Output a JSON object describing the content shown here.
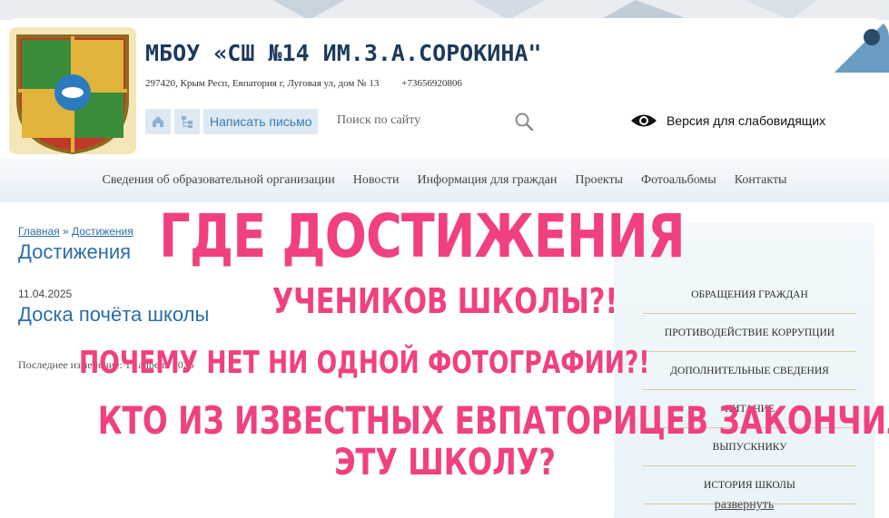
{
  "header": {
    "site_title": "МБОУ «СШ №14 ИМ.З.А.СОРОКИНА\"",
    "address": "297420, Крым Респ, Евпатория г, Луговая ул, дом № 13",
    "phone": "+73656920806",
    "write_letter": "Написать письмо",
    "search_placeholder": "Поиск по сайту",
    "accessibility_label": "Версия для слабовидящих"
  },
  "nav": {
    "items": [
      {
        "label": "Сведения об образовательной организации"
      },
      {
        "label": "Новости"
      },
      {
        "label": "Информация для граждан"
      },
      {
        "label": "Проекты"
      },
      {
        "label": "Фотоальбомы"
      },
      {
        "label": "Контакты"
      }
    ]
  },
  "main": {
    "breadcrumb_home": "Главная",
    "breadcrumb_sep": " » ",
    "breadcrumb_current": "Достижения",
    "page_title": "Достижения",
    "post_date": "11.04.2025",
    "post_title": "Доска почёта школы",
    "post_meta": "Последнее изменение: 11 апреля 2025"
  },
  "sidebar": {
    "items": [
      {
        "label": "ОБРАЩЕНИЯ ГРАЖДАН"
      },
      {
        "label": "ПРОТИВОДЕЙСТВИЕ КОРРУПЦИИ"
      },
      {
        "label": "ДОПОЛНИТЕЛЬНЫЕ СВЕДЕНИЯ"
      },
      {
        "label": "ПИТАНИЕ"
      },
      {
        "label": "ВЫПУСКНИКУ"
      },
      {
        "label": "ИСТОРИЯ ШКОЛЫ"
      }
    ],
    "expand": "развернуть"
  },
  "overlay": {
    "line1": "ГДЕ ДОСТИЖЕНИЯ",
    "line2": "УЧЕНИКОВ ШКОЛЫ?!",
    "line3": "ПОЧЕМУ НЕТ НИ ОДНОЙ ФОТОГРАФИИ?!",
    "line4": "КТО ИЗ ИЗВЕСТНЫХ ЕВПАТОРИЦЕВ ЗАКОНЧИЛ",
    "line5": "ЭТУ ШКОЛУ?"
  },
  "colors": {
    "accent": "#2a6ea8",
    "title": "#1c3a5c",
    "overlay": "#f1407f"
  }
}
